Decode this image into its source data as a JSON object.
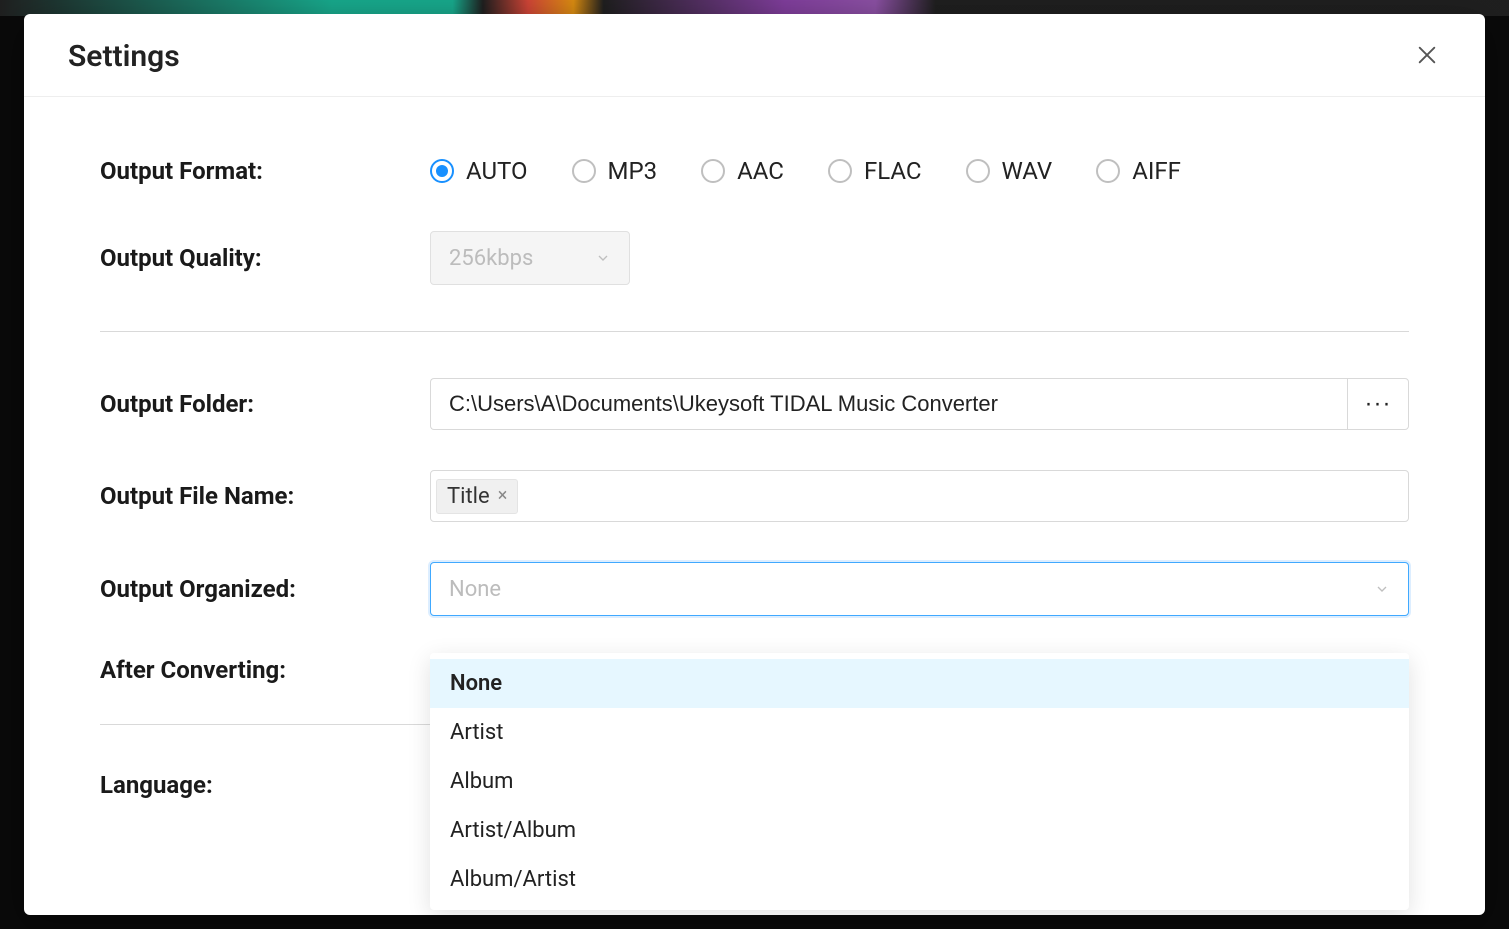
{
  "modal": {
    "title": "Settings"
  },
  "labels": {
    "output_format": "Output Format:",
    "output_quality": "Output Quality:",
    "output_folder": "Output Folder:",
    "output_file_name": "Output File Name:",
    "output_organized": "Output Organized:",
    "after_converting": "After Converting:",
    "language": "Language:"
  },
  "output_format": {
    "options": [
      "AUTO",
      "MP3",
      "AAC",
      "FLAC",
      "WAV",
      "AIFF"
    ],
    "selected": "AUTO"
  },
  "output_quality": {
    "value": "256kbps",
    "disabled": true
  },
  "output_folder": {
    "path": "C:\\Users\\A\\Documents\\Ukeysoft TIDAL Music Converter",
    "browse_icon": "···"
  },
  "output_file_name": {
    "tags": [
      "Title"
    ]
  },
  "output_organized": {
    "placeholder": "None",
    "open": true,
    "options": [
      "None",
      "Artist",
      "Album",
      "Artist/Album",
      "Album/Artist"
    ],
    "highlighted": "None"
  },
  "colors": {
    "accent": "#1890ff",
    "border": "#d9d9d9",
    "text": "#222222",
    "muted": "#bcbcbc"
  }
}
